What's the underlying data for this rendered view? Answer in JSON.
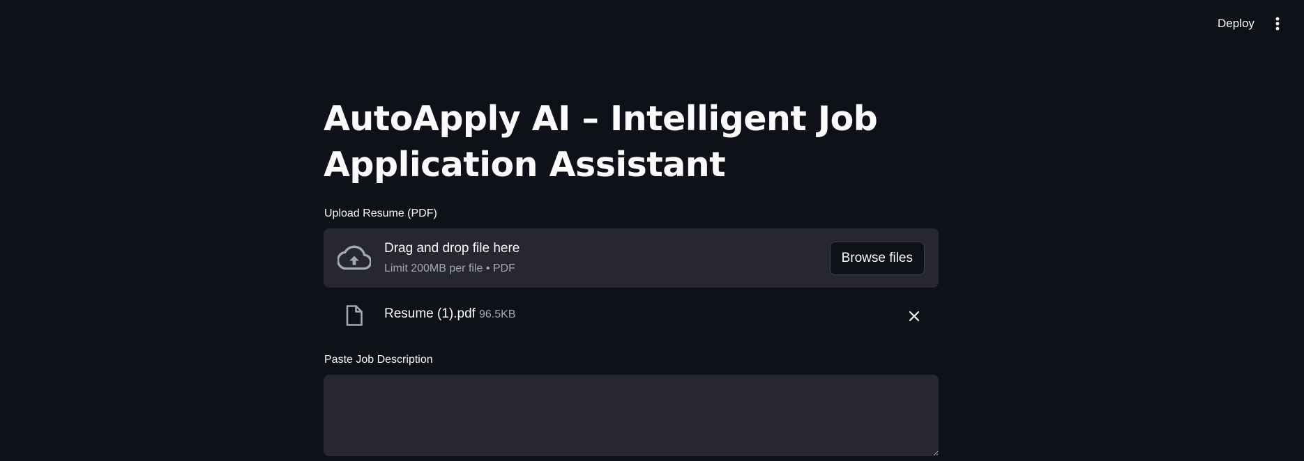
{
  "header": {
    "deploy_label": "Deploy",
    "menu_icon": "vertical-ellipsis-icon"
  },
  "main": {
    "title": "AutoApply AI – Intelligent Job Application Assistant",
    "uploader": {
      "label": "Upload Resume (PDF)",
      "dropzone_title": "Drag and drop file here",
      "dropzone_subtitle": "Limit 200MB per file • PDF",
      "browse_label": "Browse files",
      "icon": "cloud-upload-icon"
    },
    "uploaded_file": {
      "name": "Resume (1).pdf",
      "size": "96.5KB",
      "icon": "file-icon",
      "remove_icon": "close-icon"
    },
    "job_description": {
      "label": "Paste Job Description",
      "value": "",
      "placeholder": ""
    }
  },
  "colors": {
    "background": "#0e1117",
    "surface": "#262730",
    "text": "#fafafa",
    "muted_text": "#a3a8b4",
    "border": "#3d4049"
  }
}
